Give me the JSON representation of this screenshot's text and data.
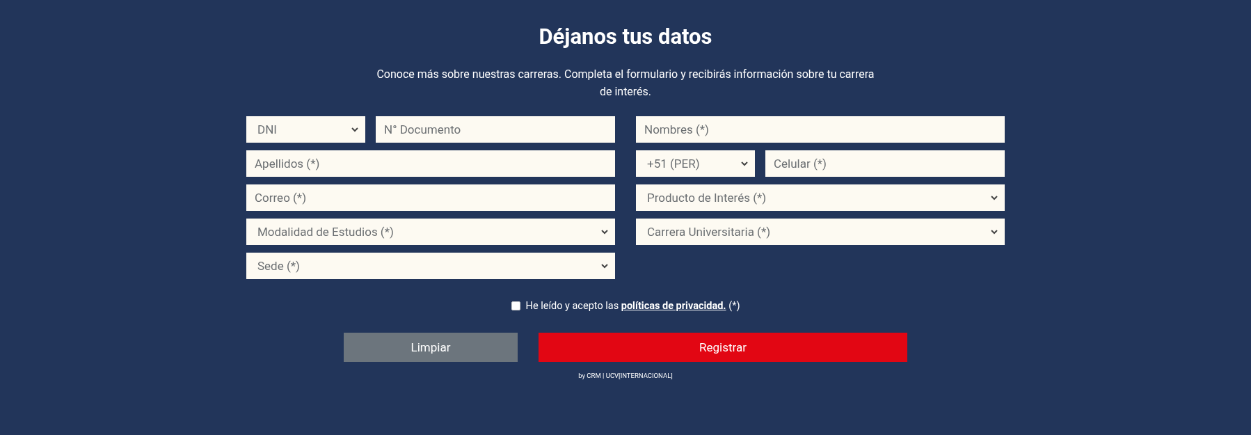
{
  "title": "Déjanos tus datos",
  "subtitle": "Conoce más sobre nuestras carreras. Completa el formulario y recibirás información sobre tu carrera de interés.",
  "left_fields": [
    [
      {
        "kind": "select",
        "value": "DNI"
      },
      {
        "kind": "input",
        "placeholder": "N° Documento"
      }
    ],
    [
      {
        "kind": "input",
        "placeholder": "Apellidos (*)"
      }
    ],
    [
      {
        "kind": "input",
        "placeholder": "Correo (*)"
      }
    ],
    [
      {
        "kind": "select",
        "value": "Modalidad de Estudios (*)"
      }
    ],
    [
      {
        "kind": "select",
        "value": "Sede (*)"
      }
    ]
  ],
  "right_fields": [
    [
      {
        "kind": "input",
        "placeholder": "Nombres (*)"
      }
    ],
    [
      {
        "kind": "select",
        "value": "+51 (PER)"
      },
      {
        "kind": "input",
        "placeholder": "Celular (*)"
      }
    ],
    [
      {
        "kind": "select",
        "value": "Producto de Interés (*)"
      }
    ],
    [
      {
        "kind": "select",
        "value": "Carrera Universitaria (*)"
      }
    ]
  ],
  "consent": {
    "checked": false,
    "text_before": "He leído y acepto las",
    "link": "políticas de privacidad.",
    "text_after": "(*)"
  },
  "buttons": [
    {
      "kind": "secondary",
      "label": "Limpiar"
    },
    {
      "kind": "primary",
      "label": "Registrar"
    }
  ],
  "footer": "by CRM | UCV[INTERNACIONAL]"
}
